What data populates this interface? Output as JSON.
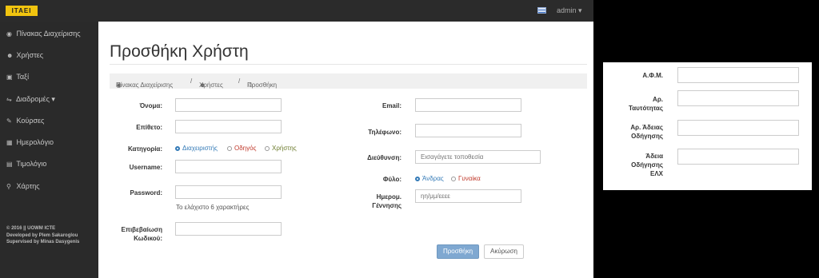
{
  "header": {
    "logo": "ITAEI",
    "user": "admin ▾"
  },
  "sidebar": {
    "items": [
      {
        "icon": "dashboard-icon",
        "glyph": "◉",
        "label": "Πίνακας Διαχείρισης"
      },
      {
        "icon": "users-icon",
        "glyph": "☻",
        "label": "Χρήστες"
      },
      {
        "icon": "car-icon",
        "glyph": "▣",
        "label": "Ταξί"
      },
      {
        "icon": "road-icon",
        "glyph": "⇋",
        "label": "Διαδρομές ▾"
      },
      {
        "icon": "comment-icon",
        "glyph": "✎",
        "label": "Κούρσες"
      },
      {
        "icon": "calendar-icon",
        "glyph": "▦",
        "label": "Ημερολόγιο"
      },
      {
        "icon": "invoice-icon",
        "glyph": "▤",
        "label": "Τιμολόγιο"
      },
      {
        "icon": "map-marker-icon",
        "glyph": "⚲",
        "label": "Χάρτης"
      }
    ],
    "footer": [
      "© 2016 || UOWM ICTE",
      "Developed by Plem Sakaroglou",
      "Supervised by Minas Dasygenis"
    ]
  },
  "page": {
    "title": "Προσθήκη Χρήστη",
    "breadcrumb": [
      "Πίνακας Διαχείρισης",
      "/",
      "Χρήστες",
      "/",
      "Προσθήκη"
    ]
  },
  "form": {
    "name_label": "Όνομα:",
    "surname_label": "Επίθετο:",
    "category_label": "Κατηγορία:",
    "category_options": [
      "Διαχειριστής",
      "Οδηγός",
      "Χρήστης"
    ],
    "username_label": "Username:",
    "password_label": "Password:",
    "password_help": "Το ελάχιστο 6 χαρακτήρες",
    "confirm_label_1": "Επιβεβαίωση",
    "confirm_label_2": "Κωδικού:",
    "email_label": "Email:",
    "phone_label": "Τηλέφωνο:",
    "address_label": "Διεύθυνση:",
    "address_placeholder": "Εισαγάγετε τοποθεσία",
    "gender_label": "Φύλο:",
    "gender_options": [
      "Άνδρας",
      "Γυναίκα"
    ],
    "birth_label_1": "Ημερομ.",
    "birth_label_2": "Γέννησης",
    "birth_placeholder": "ηη/μμ/εεεε",
    "submit": "Προσθήκη",
    "cancel": "Ακύρωση"
  },
  "driver_card": {
    "afm_label": "Α.Φ.Μ.",
    "id_label_1": "Αρ.",
    "id_label_2": "Ταυτότητας",
    "license_label_1": "Αρ. Άδειας",
    "license_label_2": "Οδήγησης",
    "elx_label_1": "Άδεια",
    "elx_label_2": "Οδήγησης",
    "elx_label_3": "ΕΛΧ"
  },
  "colors": {
    "accent": "#337ab7",
    "logo": "#f1c40f",
    "driver_radio": "#c0392b"
  }
}
